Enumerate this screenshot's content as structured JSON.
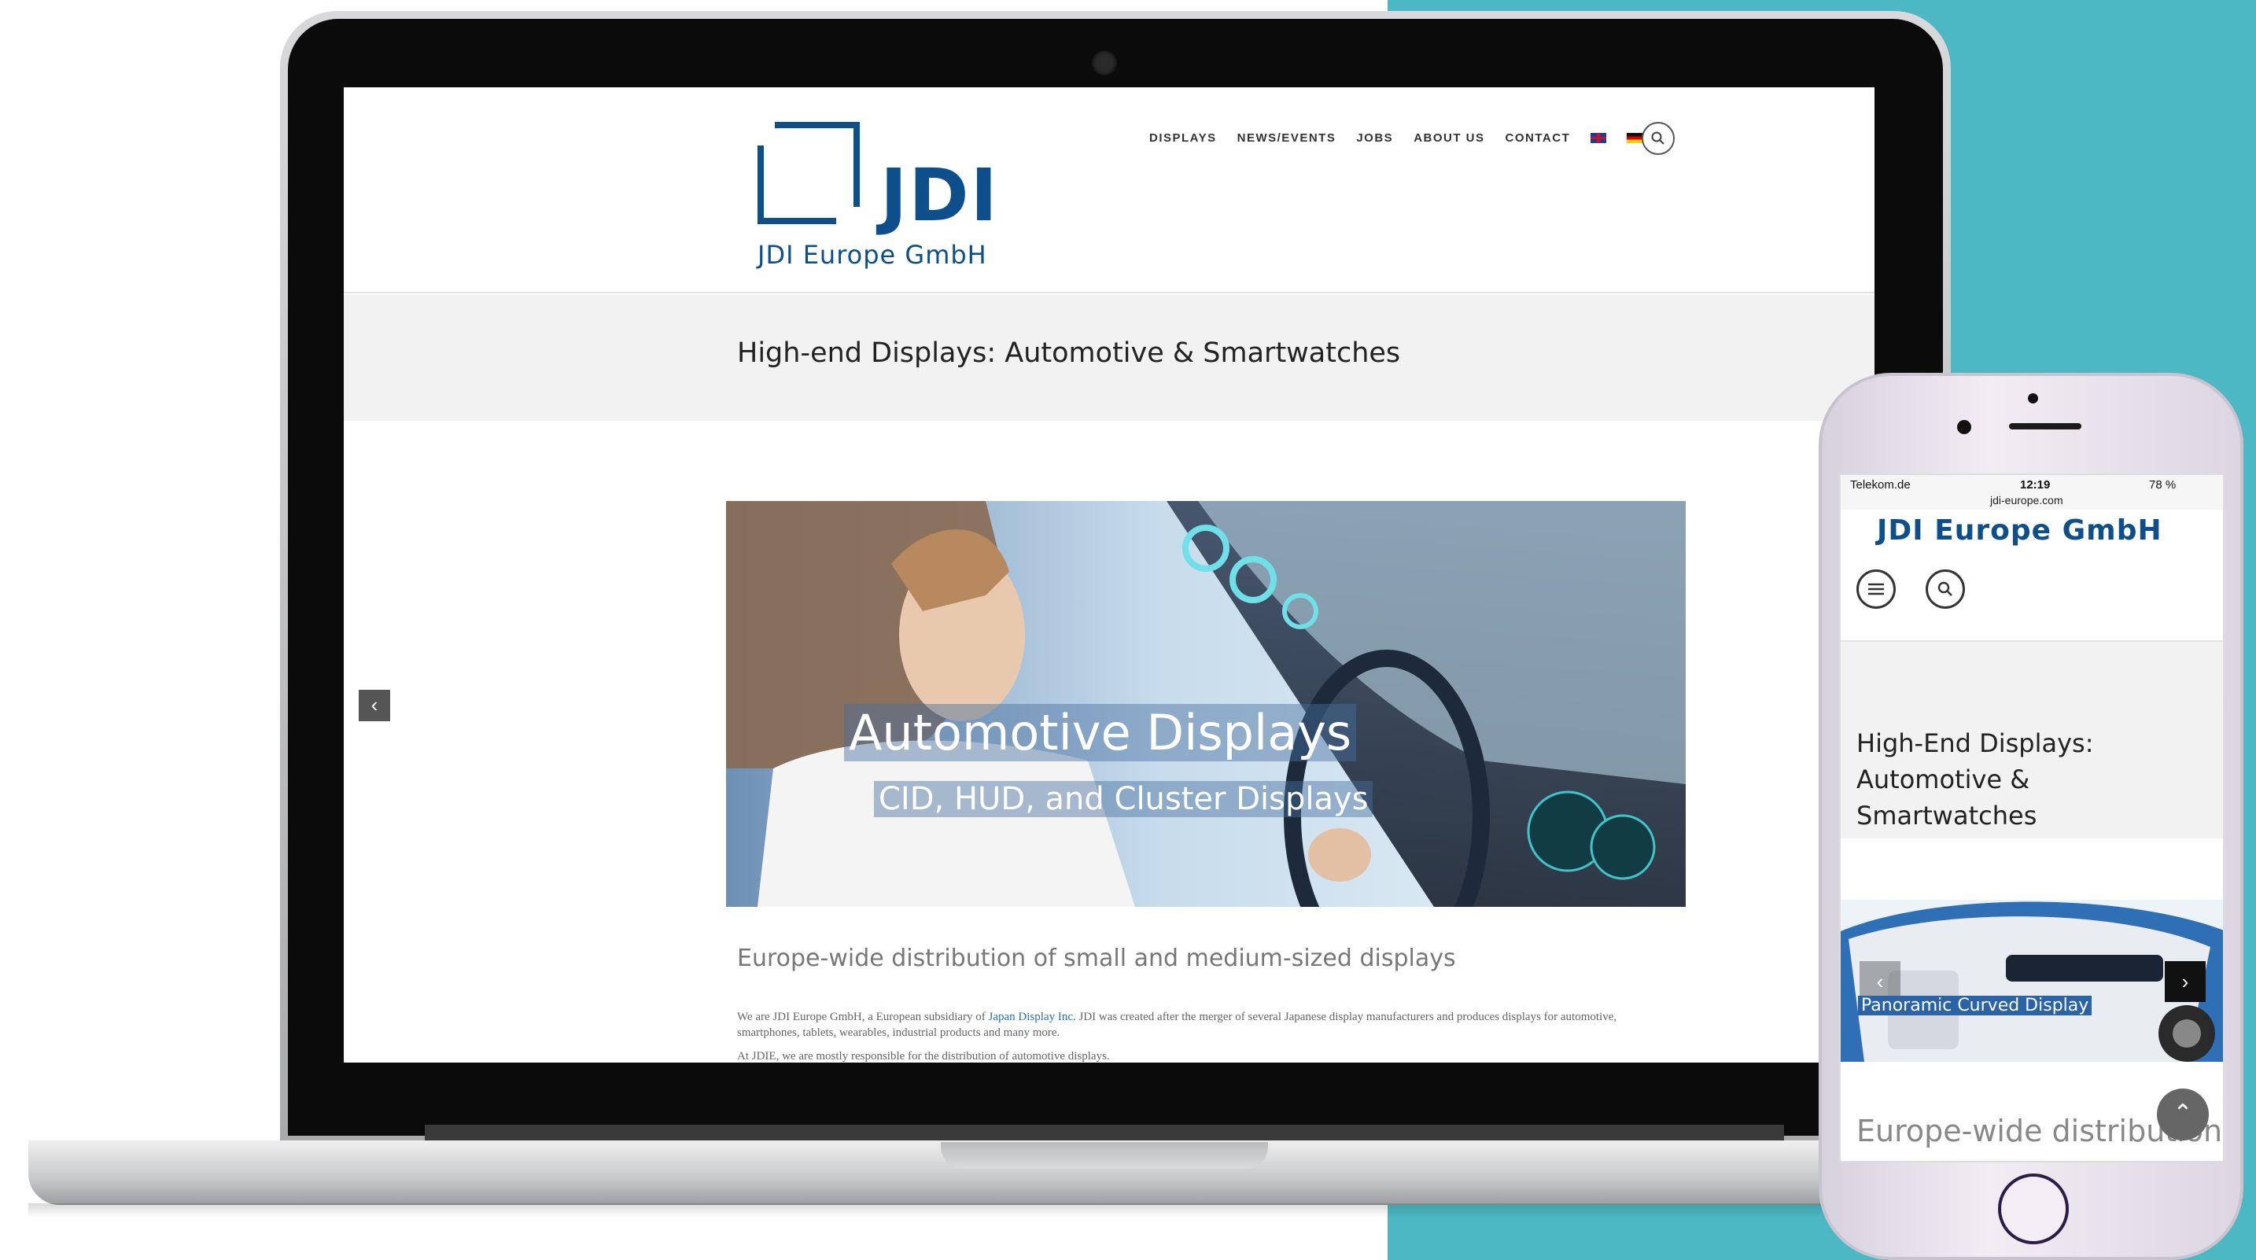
{
  "desktop": {
    "nav": [
      "DISPLAYS",
      "NEWS/EVENTS",
      "JOBS",
      "ABOUT US",
      "CONTACT"
    ],
    "logo": {
      "word": "JDI",
      "sub": "JDI Europe GmbH"
    },
    "page_title": "High-end Displays: Automotive & Smartwatches",
    "hero": {
      "title": "Automotive Displays",
      "subtitle": "CID, HUD, and Cluster Displays"
    },
    "slider_prev": "‹",
    "section_heading": "Europe-wide distribution of small and medium-sized displays",
    "body": {
      "p1_before": "We are JDI Europe GmbH, a European subsidiary of",
      "p1_link": "Japan Display Inc.",
      "p1_after": "JDI was created after the merger of several Japanese display manufacturers and produces displays for automotive, smartphones, tablets, wearables, industrial products and many more.",
      "p2": "At JDIE, we are mostly responsible for the distribution of automotive displays."
    }
  },
  "mobile": {
    "status": {
      "carrier": "Telekom.de",
      "time": "12:19",
      "battery": "78 %",
      "url": "jdi-europe.com"
    },
    "logo": "JDI Europe GmbH",
    "title": "High-End Displays: Automotive & Smartwatches",
    "hero_label": "Panoramic Curved Display",
    "prev": "‹",
    "next": "›",
    "section_heading": "Europe-wide distribution",
    "to_top": "⌃"
  }
}
